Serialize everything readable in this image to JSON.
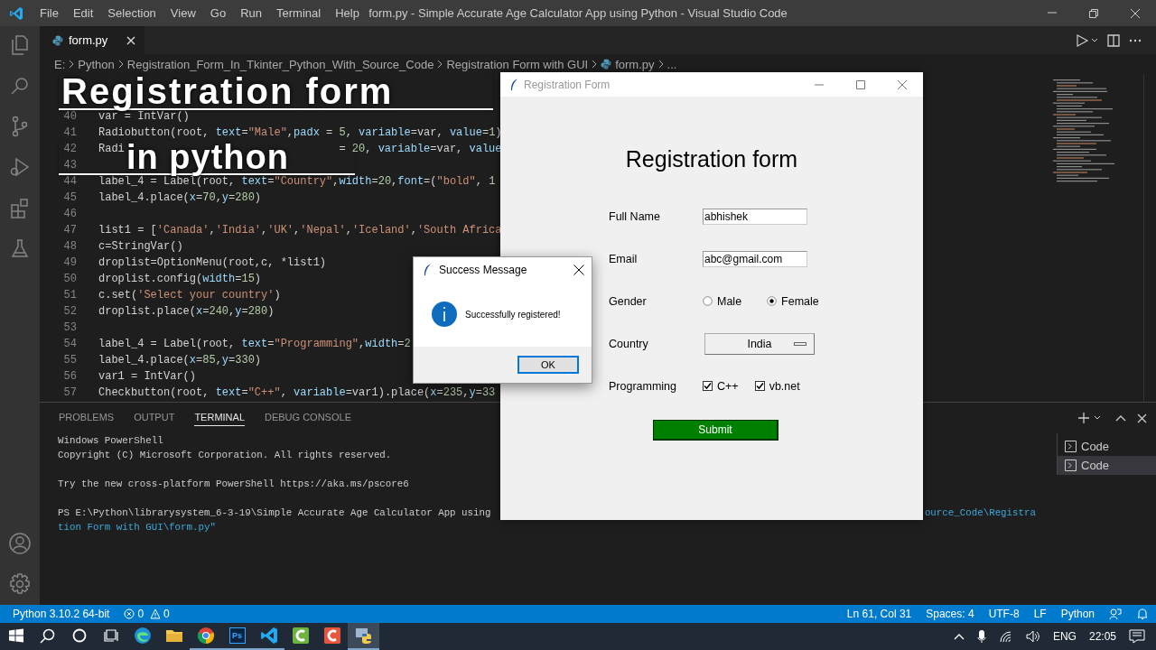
{
  "titlebar": {
    "menu": [
      "File",
      "Edit",
      "Selection",
      "View",
      "Go",
      "Run",
      "Terminal",
      "Help"
    ],
    "title": "form.py - Simple Accurate Age Calculator App using Python - Visual Studio Code"
  },
  "editor": {
    "tabs": [
      {
        "label": "form.py",
        "selected": true
      }
    ],
    "breadcrumb": [
      "E:",
      "Python",
      "Registration_Form_In_Tkinter_Python_With_Source_Code",
      "Registration Form with GUI",
      "form.py",
      "..."
    ],
    "lines": [
      {
        "number": "40",
        "code": [
          {
            "kind": "plain",
            "text": "var = IntVar()"
          }
        ]
      },
      {
        "number": "41",
        "code": [
          {
            "kind": "plain",
            "text": "Radiobutton(root, "
          },
          {
            "kind": "param",
            "text": "text"
          },
          {
            "kind": "plain",
            "text": "="
          },
          {
            "kind": "string",
            "text": "\"Male\""
          },
          {
            "kind": "plain",
            "text": ","
          },
          {
            "kind": "param",
            "text": "padx"
          },
          {
            "kind": "plain",
            "text": " = "
          },
          {
            "kind": "number",
            "text": "5"
          },
          {
            "kind": "plain",
            "text": ", "
          },
          {
            "kind": "param",
            "text": "variable"
          },
          {
            "kind": "plain",
            "text": "=var, "
          },
          {
            "kind": "param",
            "text": "value"
          },
          {
            "kind": "plain",
            "text": "="
          },
          {
            "kind": "number",
            "text": "1"
          },
          {
            "kind": "plain",
            "text": ")"
          }
        ]
      },
      {
        "number": "42",
        "code": [
          {
            "kind": "plain",
            "text": "Radi"
          },
          {
            "kind": "gap",
            "text": "                                 = "
          },
          {
            "kind": "number",
            "text": "20"
          },
          {
            "kind": "plain",
            "text": ", "
          },
          {
            "kind": "param",
            "text": "variable"
          },
          {
            "kind": "plain",
            "text": "=var, "
          },
          {
            "kind": "param",
            "text": "value"
          }
        ]
      },
      {
        "number": "43"
      },
      {
        "number": "44",
        "code": [
          {
            "kind": "plain",
            "text": "label_4 = Label(root, "
          },
          {
            "kind": "param",
            "text": "text"
          },
          {
            "kind": "plain",
            "text": "="
          },
          {
            "kind": "string",
            "text": "\"Country\""
          },
          {
            "kind": "plain",
            "text": ","
          },
          {
            "kind": "param",
            "text": "width"
          },
          {
            "kind": "plain",
            "text": "="
          },
          {
            "kind": "number",
            "text": "20"
          },
          {
            "kind": "plain",
            "text": ","
          },
          {
            "kind": "param",
            "text": "font"
          },
          {
            "kind": "plain",
            "text": "=("
          },
          {
            "kind": "string",
            "text": "\"bold\""
          },
          {
            "kind": "plain",
            "text": ", "
          },
          {
            "kind": "number",
            "text": "1"
          }
        ]
      },
      {
        "number": "45",
        "code": [
          {
            "kind": "plain",
            "text": "label_4.place("
          },
          {
            "kind": "param",
            "text": "x"
          },
          {
            "kind": "plain",
            "text": "="
          },
          {
            "kind": "number",
            "text": "70"
          },
          {
            "kind": "plain",
            "text": ","
          },
          {
            "kind": "param",
            "text": "y"
          },
          {
            "kind": "plain",
            "text": "="
          },
          {
            "kind": "number",
            "text": "280"
          },
          {
            "kind": "plain",
            "text": ")"
          }
        ]
      },
      {
        "number": "46"
      },
      {
        "number": "47",
        "code": [
          {
            "kind": "plain",
            "text": "list1 = ["
          },
          {
            "kind": "string",
            "text": "'Canada'"
          },
          {
            "kind": "plain",
            "text": ","
          },
          {
            "kind": "string",
            "text": "'India'"
          },
          {
            "kind": "plain",
            "text": ","
          },
          {
            "kind": "string",
            "text": "'UK'"
          },
          {
            "kind": "plain",
            "text": ","
          },
          {
            "kind": "string",
            "text": "'Nepal'"
          },
          {
            "kind": "plain",
            "text": ","
          },
          {
            "kind": "string",
            "text": "'Iceland'"
          },
          {
            "kind": "plain",
            "text": ","
          },
          {
            "kind": "string",
            "text": "'South Africa"
          }
        ]
      },
      {
        "number": "48",
        "code": [
          {
            "kind": "plain",
            "text": "c=StringVar()"
          }
        ]
      },
      {
        "number": "49",
        "code": [
          {
            "kind": "plain",
            "text": "droplist=OptionMenu(root,c, *list1)"
          }
        ]
      },
      {
        "number": "50",
        "code": [
          {
            "kind": "plain",
            "text": "droplist.config("
          },
          {
            "kind": "param",
            "text": "width"
          },
          {
            "kind": "plain",
            "text": "="
          },
          {
            "kind": "number",
            "text": "15"
          },
          {
            "kind": "plain",
            "text": ")"
          }
        ]
      },
      {
        "number": "51",
        "code": [
          {
            "kind": "plain",
            "text": "c.set("
          },
          {
            "kind": "string",
            "text": "'Select your country'"
          },
          {
            "kind": "plain",
            "text": ")"
          }
        ]
      },
      {
        "number": "52",
        "code": [
          {
            "kind": "plain",
            "text": "droplist.place("
          },
          {
            "kind": "param",
            "text": "x"
          },
          {
            "kind": "plain",
            "text": "="
          },
          {
            "kind": "number",
            "text": "240"
          },
          {
            "kind": "plain",
            "text": ","
          },
          {
            "kind": "param",
            "text": "y"
          },
          {
            "kind": "plain",
            "text": "="
          },
          {
            "kind": "number",
            "text": "280"
          },
          {
            "kind": "plain",
            "text": ")"
          }
        ]
      },
      {
        "number": "53"
      },
      {
        "number": "54",
        "code": [
          {
            "kind": "plain",
            "text": "label_4 = Label(root, "
          },
          {
            "kind": "param",
            "text": "text"
          },
          {
            "kind": "plain",
            "text": "="
          },
          {
            "kind": "string",
            "text": "\"Programming\""
          },
          {
            "kind": "plain",
            "text": ","
          },
          {
            "kind": "param",
            "text": "width"
          },
          {
            "kind": "plain",
            "text": "="
          },
          {
            "kind": "number",
            "text": "2"
          }
        ]
      },
      {
        "number": "55",
        "code": [
          {
            "kind": "plain",
            "text": "label_4.place("
          },
          {
            "kind": "param",
            "text": "x"
          },
          {
            "kind": "plain",
            "text": "="
          },
          {
            "kind": "number",
            "text": "85"
          },
          {
            "kind": "plain",
            "text": ","
          },
          {
            "kind": "param",
            "text": "y"
          },
          {
            "kind": "plain",
            "text": "="
          },
          {
            "kind": "number",
            "text": "330"
          },
          {
            "kind": "plain",
            "text": ")"
          }
        ]
      },
      {
        "number": "56",
        "code": [
          {
            "kind": "plain",
            "text": "var1 = IntVar()"
          }
        ]
      },
      {
        "number": "57",
        "code": [
          {
            "kind": "plain",
            "text": "Checkbutton(root, "
          },
          {
            "kind": "param",
            "text": "text"
          },
          {
            "kind": "plain",
            "text": "="
          },
          {
            "kind": "string",
            "text": "\"C++\""
          },
          {
            "kind": "plain",
            "text": ", "
          },
          {
            "kind": "param",
            "text": "variable"
          },
          {
            "kind": "plain",
            "text": "=var1).place("
          },
          {
            "kind": "param",
            "text": "x"
          },
          {
            "kind": "plain",
            "text": "="
          },
          {
            "kind": "number",
            "text": "235"
          },
          {
            "kind": "plain",
            "text": ","
          },
          {
            "kind": "param",
            "text": "y"
          },
          {
            "kind": "plain",
            "text": "="
          },
          {
            "kind": "number",
            "text": "33"
          }
        ]
      }
    ]
  },
  "panel": {
    "tabs": [
      {
        "label": "PROBLEMS",
        "selected": false
      },
      {
        "label": "OUTPUT",
        "selected": false
      },
      {
        "label": "TERMINAL",
        "selected": true
      },
      {
        "label": "DEBUG CONSOLE",
        "selected": false
      }
    ],
    "lines": [
      {
        "kind": "text",
        "segments": [
          {
            "kind": "plain",
            "text": "Windows PowerShell"
          }
        ]
      },
      {
        "kind": "text",
        "segments": [
          {
            "kind": "plain",
            "text": "Copyright (C) Microsoft Corporation. All rights reserved."
          }
        ]
      },
      {
        "kind": "blank"
      },
      {
        "kind": "text",
        "segments": [
          {
            "kind": "plain",
            "text": "Try the new cross-platform PowerShell https://aka.ms/pscore6"
          }
        ]
      },
      {
        "kind": "blank"
      },
      {
        "kind": "split",
        "segments": [
          {
            "kind": "plain",
            "text": "PS E:\\Python\\librarysystem_6-3-19\\Simple Accurate Age Calculator App using"
          },
          {
            "kind": "path",
            "text": "ource_Code\\Registra"
          }
        ]
      },
      {
        "kind": "text",
        "segments": [
          {
            "kind": "path",
            "text": "tion Form with GUI\\form.py\""
          }
        ]
      }
    ],
    "sessions": [
      {
        "label": "Code",
        "selected": false
      },
      {
        "label": "Code",
        "selected": true
      }
    ]
  },
  "status_bar": {
    "interpreter": "Python 3.10.2 64-bit",
    "errors": "0",
    "warnings": "0",
    "items": [
      "Ln 61, Col 31",
      "Spaces: 4",
      "UTF-8",
      "LF",
      "Python"
    ]
  },
  "taskbar": {
    "apps": [
      {
        "kind": "edge",
        "running": false,
        "selected": false
      },
      {
        "kind": "folder",
        "running": false,
        "selected": false
      },
      {
        "kind": "chrome",
        "running": true,
        "selected": false
      },
      {
        "kind": "photoshop",
        "label": "Ps",
        "running": true,
        "selected": false
      },
      {
        "kind": "vscode",
        "running": true,
        "selected": false
      },
      {
        "kind": "green-app",
        "running": false,
        "selected": false
      },
      {
        "kind": "red-app",
        "running": false,
        "selected": false
      },
      {
        "kind": "python",
        "running": true,
        "selected": true
      }
    ],
    "language": "ENG",
    "time": "22:05"
  },
  "form_window": {
    "title": "Registration Form",
    "heading": "Registration form",
    "fields": [
      {
        "kind": "text",
        "label": "Full Name",
        "value": "abhishek"
      },
      {
        "kind": "text",
        "label": "Email",
        "value": "abc@gmail.com"
      },
      {
        "kind": "radio",
        "label": "Gender",
        "options": [
          {
            "label": "Male",
            "selected": false
          },
          {
            "label": "Female",
            "selected": true
          }
        ]
      },
      {
        "kind": "dropdown",
        "label": "Country",
        "value": "India"
      },
      {
        "kind": "checkbox",
        "label": "Programming",
        "options": [
          {
            "label": "C++",
            "checked": true
          },
          {
            "label": "vb.net",
            "checked": true
          }
        ]
      }
    ],
    "submit": "Submit"
  },
  "dialog": {
    "title": "Success Message",
    "message": "Successfully registered!",
    "button": "OK"
  },
  "caption": {
    "lines": [
      "Registration form",
      "in python"
    ]
  }
}
